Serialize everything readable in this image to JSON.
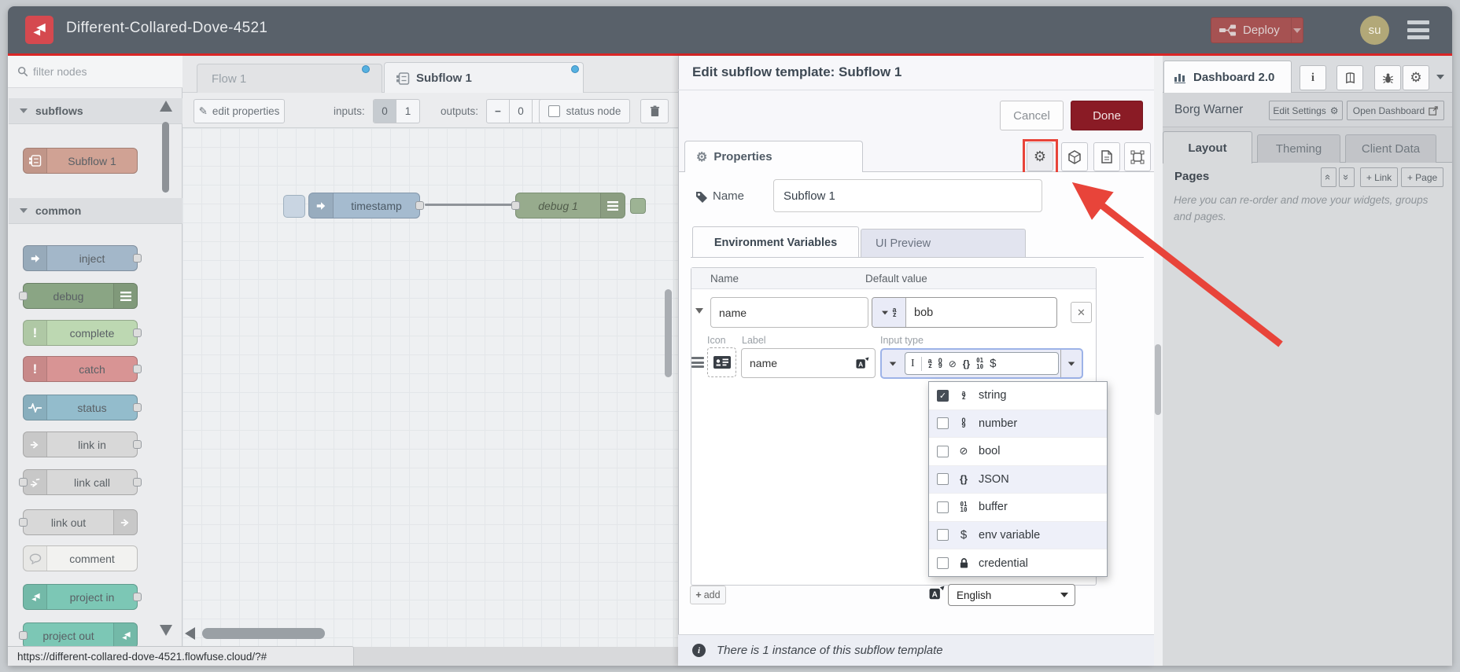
{
  "header": {
    "title": "Different-Collared-Dove-4521",
    "deploy_label": "Deploy",
    "avatar_initials": "su"
  },
  "statusbar": {
    "url": "https://different-collared-dove-4521.flowfuse.cloud/?#"
  },
  "palette": {
    "filter_placeholder": "filter nodes",
    "category_subflows": "subflows",
    "category_common": "common",
    "nodes": [
      {
        "label": "Subflow 1",
        "color": "#d0a294"
      },
      {
        "label": "inject",
        "color": "#a3b7c9"
      },
      {
        "label": "debug",
        "color": "#8aa584"
      },
      {
        "label": "complete",
        "color": "#bdd8b2"
      },
      {
        "label": "catch",
        "color": "#d89494"
      },
      {
        "label": "status",
        "color": "#93bccc"
      },
      {
        "label": "link in",
        "color": "#d8d8d8"
      },
      {
        "label": "link call",
        "color": "#d8d8d8"
      },
      {
        "label": "link out",
        "color": "#d8d8d8"
      },
      {
        "label": "comment",
        "color": "#f2f2f0"
      },
      {
        "label": "project in",
        "color": "#7cc7b5"
      },
      {
        "label": "project out",
        "color": "#7cc7b5"
      }
    ]
  },
  "workspace": {
    "tab_flow1": "Flow 1",
    "tab_subflow1": "Subflow 1",
    "toolbar": {
      "edit_properties": "edit properties",
      "inputs_label": "inputs:",
      "input_opt_0": "0",
      "input_opt_1": "1",
      "outputs_label": "outputs:",
      "outputs_value": "0",
      "status_node": "status node"
    },
    "node_timestamp": "timestamp",
    "node_debug": "debug 1"
  },
  "dialog": {
    "title": "Edit subflow template: Subflow 1",
    "cancel": "Cancel",
    "done": "Done",
    "properties_tab": "Properties",
    "name_label": "Name",
    "name_value": "Subflow 1",
    "tab_env": "Environment Variables",
    "tab_preview": "UI Preview",
    "col_name": "Name",
    "col_default": "Default value",
    "env_name": "name",
    "env_value": "bob",
    "icon_label": "Icon",
    "label_label": "Label",
    "label_value": "name",
    "input_type_label": "Input type",
    "type_options": [
      {
        "label": "string",
        "checked": true
      },
      {
        "label": "number",
        "checked": false
      },
      {
        "label": "bool",
        "checked": false
      },
      {
        "label": "JSON",
        "checked": false
      },
      {
        "label": "buffer",
        "checked": false
      },
      {
        "label": "env variable",
        "checked": false
      },
      {
        "label": "credential",
        "checked": false
      }
    ],
    "add_button": "add",
    "language_value": "English",
    "footer_note": "There is 1 instance of this subflow template"
  },
  "sidebar": {
    "dashboard_tab": "Dashboard 2.0",
    "instance_name": "Borg Warner",
    "edit_settings": "Edit Settings",
    "open_dashboard": "Open Dashboard",
    "tab_layout": "Layout",
    "tab_theming": "Theming",
    "tab_clientdata": "Client Data",
    "pages_title": "Pages",
    "btn_link": "+ Link",
    "btn_page": "+ Page",
    "help_text": "Here you can re-order and move your widgets, groups and pages."
  },
  "icons": {
    "gear": "⚙",
    "pencil": "✎",
    "close": "✕",
    "check": "✓",
    "minus": "−",
    "plus": "+",
    "exclaim": "!",
    "info_i": "i",
    "ibeam": "I",
    "braces": "{}",
    "dollar": "$",
    "bool": "⊘",
    "az_a": "a",
    "az_z": "z",
    "num_0": "0",
    "num_9": "9",
    "buf_01": "01",
    "buf_10": "10",
    "dbl_chevron": "«",
    "dbl_chevron_r": "»"
  },
  "colors": {
    "header_bg": "#59616a",
    "accent_red_line": "#d92626",
    "logo_red": "#d5494f",
    "deploy_bg": "#a65252",
    "done_bg": "#8a1b25",
    "annotation_red": "#e8443a",
    "modified_dot_blue": "#56b1e0",
    "avatar_bg": "#b2a878"
  }
}
